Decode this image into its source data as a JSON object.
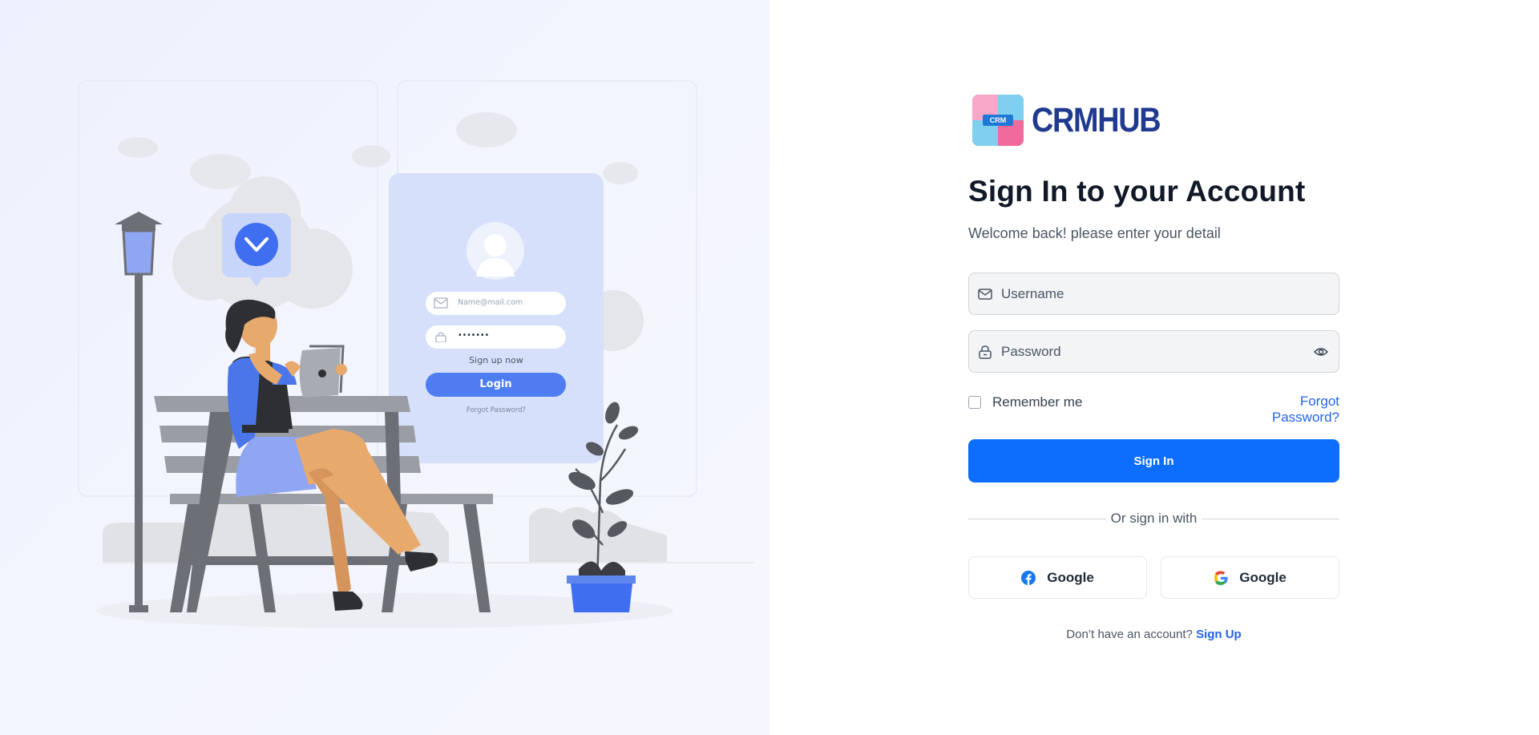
{
  "illustration": {
    "mock_email_placeholder": "Name@mail.com",
    "mock_password_value": "•••••••",
    "mock_signup_text": "Sign up now",
    "mock_login_label": "Login",
    "mock_forgot_text": "Forgot Password?",
    "colors": {
      "primary": "#4d7df0",
      "card": "#d6e0fb",
      "bench": "#9a9da3"
    }
  },
  "brand": {
    "logo_badge": "CRM",
    "name": "CRMHUB",
    "colors": {
      "brand_text": "#1f3a8f"
    }
  },
  "form": {
    "title": "Sign In to your Account",
    "subtitle": "Welcome back! please enter your detail",
    "username_placeholder": "Username",
    "password_placeholder": "Password",
    "remember_label": "Remember me",
    "forgot_label": "Forgot Password?",
    "submit_label": "Sign In",
    "divider_text": "Or sign in with",
    "social": [
      {
        "label": "Google",
        "icon": "facebook-icon"
      },
      {
        "label": "Google",
        "icon": "google-icon"
      }
    ],
    "signup_prompt": "Don’t have an account?",
    "signup_link": "Sign Up",
    "colors": {
      "primary": "#0d6efd",
      "link": "#2563eb"
    }
  }
}
